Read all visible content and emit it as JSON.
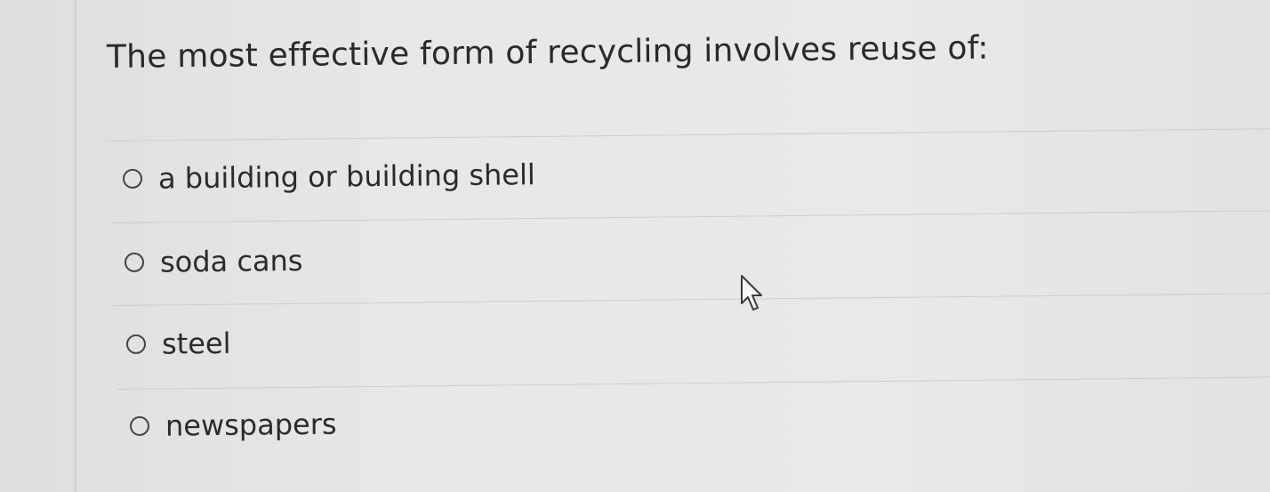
{
  "question": {
    "text": "The most effective form of recycling involves reuse of:"
  },
  "answers": [
    {
      "label": "a building or building shell",
      "selected": false
    },
    {
      "label": "soda cans",
      "selected": false
    },
    {
      "label": "steel",
      "selected": false
    },
    {
      "label": "newspapers",
      "selected": false
    }
  ],
  "pointer": {
    "icon": "mouse-pointer-icon"
  }
}
